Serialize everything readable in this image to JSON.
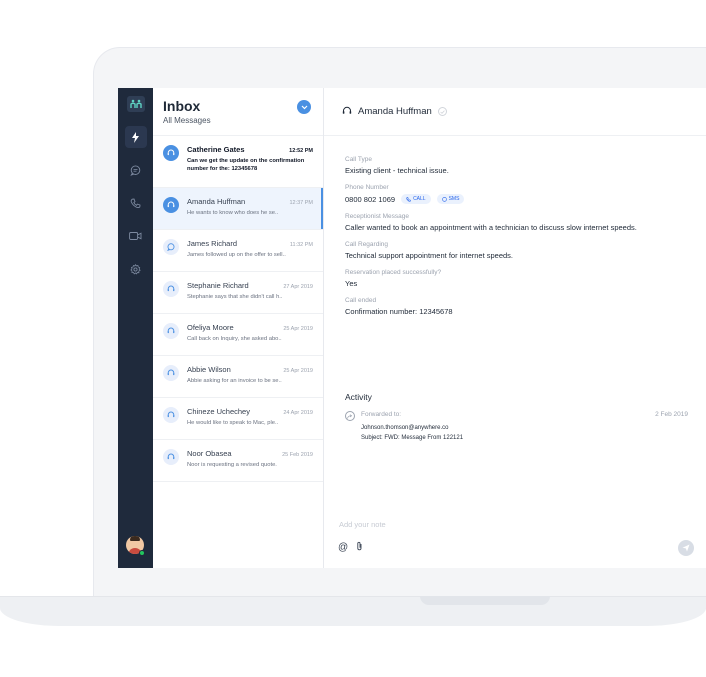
{
  "inbox": {
    "title": "Inbox",
    "subtitle": "All Messages",
    "conversations": [
      {
        "name": "Catherine Gates",
        "time": "12:52 PM",
        "preview": "Can we get the update on the confirmation number for the: 12345678",
        "unread": true,
        "icon": "headset-icon"
      },
      {
        "name": "Amanda Huffman",
        "time": "12:37 PM",
        "preview": "He wants to know who does he se..",
        "selected": true,
        "icon": "headset-icon"
      },
      {
        "name": "James Richard",
        "time": "11:32 PM",
        "preview": "James followed up on the offer to sell..",
        "icon": "chat-bubble-icon"
      },
      {
        "name": "Stephanie Richard",
        "time": "27 Apr 2019",
        "preview": "Stephanie says that she didn't call h..",
        "icon": "headset-icon"
      },
      {
        "name": "Ofeliya Moore",
        "time": "25 Apr 2019",
        "preview": "Call back on Inquiry, she asked abo..",
        "icon": "headset-icon"
      },
      {
        "name": "Abbie Wilson",
        "time": "25 Apr 2019",
        "preview": "Abbie asking for an invoice to be se..",
        "icon": "headset-icon"
      },
      {
        "name": "Chineze Uchechey",
        "time": "24 Apr 2019",
        "preview": "He would like to speak to Mac, ple..",
        "icon": "headset-icon"
      },
      {
        "name": "Noor Obasea",
        "time": "25 Feb 2019",
        "preview": "Noor is requesting a revised quote.",
        "icon": "headset-icon"
      }
    ]
  },
  "detail": {
    "contact_name": "Amanda Huffman",
    "fields": {
      "call_type_label": "Call Type",
      "call_type_value": "Existing client - technical issue.",
      "phone_label": "Phone Number",
      "phone_value": "0800 802 1069",
      "call_pill": "CALL",
      "sms_pill": "SMS",
      "receptionist_label": "Receptionist Message",
      "receptionist_value": "Caller wanted to book an appointment with a technician to discuss slow internet speeds.",
      "regarding_label": "Call Regarding",
      "regarding_value": "Technical support appointment for internet speeds.",
      "reservation_label": "Reservation placed successfully?",
      "reservation_value": "Yes",
      "ended_label": "Call ended",
      "ended_value": "Confirmation number: 12345678"
    },
    "activity": {
      "title": "Activity",
      "entry_label": "Forwarded to:",
      "entry_date": "2 Feb 2019",
      "entry_email": "Johnson.thomson@anywhere.co",
      "entry_subject": "Subject: FWD: Message From 122121"
    },
    "composer": {
      "placeholder": "Add your note",
      "mention_symbol": "@"
    }
  },
  "colors": {
    "rail": "#1f2a3c",
    "accent": "#4a90e2",
    "selected_bg": "#eef4fd",
    "online": "#22c55e"
  }
}
